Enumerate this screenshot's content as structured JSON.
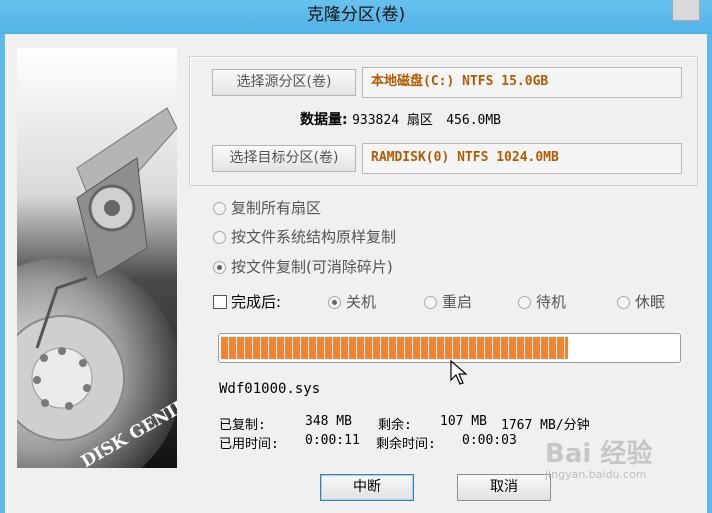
{
  "window": {
    "title": "克隆分区(卷)"
  },
  "source": {
    "button_label": "选择源分区(卷)",
    "value": "本地磁盘(C:) NTFS 15.0GB"
  },
  "data_info": {
    "label": "数据量:",
    "sectors": "933824 扇区",
    "size": "456.0MB"
  },
  "target": {
    "button_label": "选择目标分区(卷)",
    "value": "RAMDISK(0) NTFS 1024.0MB"
  },
  "copy_modes": [
    {
      "label": "复制所有扇区",
      "checked": false
    },
    {
      "label": "按文件系统结构原样复制",
      "checked": false
    },
    {
      "label": "按文件复制(可消除碎片)",
      "checked": true
    }
  ],
  "after_complete": {
    "label": "完成后:",
    "checked": false,
    "options": [
      {
        "label": "关机",
        "checked": true
      },
      {
        "label": "重启",
        "checked": false
      },
      {
        "label": "待机",
        "checked": false
      },
      {
        "label": "休眠",
        "checked": false
      }
    ]
  },
  "progress": {
    "fraction": 0.76
  },
  "current_file": "Wdf01000.sys",
  "stats": {
    "copied_label": "已复制:",
    "copied_value": "348 MB",
    "remaining_label": "剩余:",
    "remaining_value": "107 MB",
    "speed": "1767 MB/分钟",
    "elapsed_label": "已用时间:",
    "elapsed_value": "0:00:11",
    "remaining_time_label": "剩余时间:",
    "remaining_time_value": "0:00:03"
  },
  "buttons": {
    "abort": "中断",
    "cancel": "取消"
  },
  "side_image": {
    "brand_text": "DISK GENIUS"
  },
  "watermark": {
    "text": "Bai 经验",
    "sub": "jingyan.baidu.com"
  }
}
